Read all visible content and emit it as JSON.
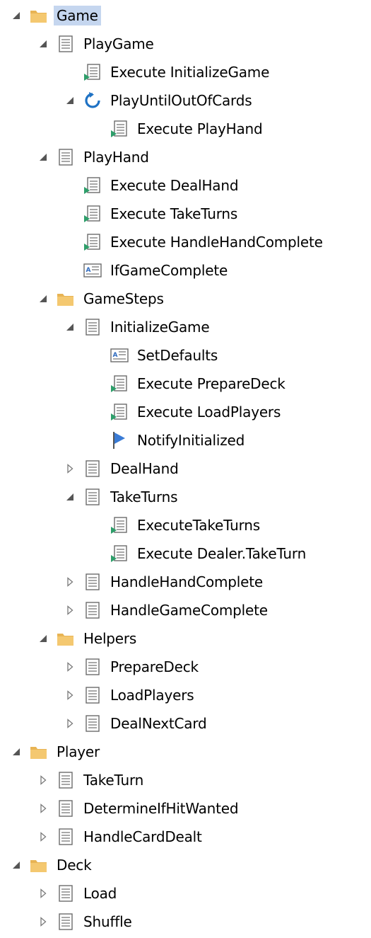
{
  "colors": {
    "selection": "#c5d6ef",
    "folder": "#f4c870",
    "folder_tab": "#e8b454",
    "flag": "#3a7bd5",
    "loop": "#1f72c4",
    "execute_arrow": "#2e9e6a",
    "expander": "#555555"
  },
  "tree": [
    {
      "label": "Game",
      "level": 0,
      "icon": "folder-icon",
      "expander": "expanded",
      "selected": true
    },
    {
      "label": "PlayGame",
      "level": 1,
      "icon": "document-icon",
      "expander": "expanded"
    },
    {
      "label": "Execute InitializeGame",
      "level": 2,
      "icon": "execute-icon",
      "expander": "none"
    },
    {
      "label": "PlayUntilOutOfCards",
      "level": 2,
      "icon": "loop-icon",
      "expander": "expanded"
    },
    {
      "label": "Execute PlayHand",
      "level": 3,
      "icon": "execute-icon",
      "expander": "none"
    },
    {
      "label": "PlayHand",
      "level": 1,
      "icon": "document-icon",
      "expander": "expanded"
    },
    {
      "label": "Execute DealHand",
      "level": 2,
      "icon": "execute-icon",
      "expander": "none"
    },
    {
      "label": "Execute TakeTurns",
      "level": 2,
      "icon": "execute-icon",
      "expander": "none"
    },
    {
      "label": "Execute HandleHandComplete",
      "level": 2,
      "icon": "execute-icon",
      "expander": "none"
    },
    {
      "label": "IfGameComplete",
      "level": 2,
      "icon": "condition-icon",
      "expander": "none"
    },
    {
      "label": "GameSteps",
      "level": 1,
      "icon": "folder-icon",
      "expander": "expanded"
    },
    {
      "label": "InitializeGame",
      "level": 2,
      "icon": "document-icon",
      "expander": "expanded"
    },
    {
      "label": "SetDefaults",
      "level": 3,
      "icon": "condition-icon",
      "expander": "none"
    },
    {
      "label": "Execute PrepareDeck",
      "level": 3,
      "icon": "execute-icon",
      "expander": "none"
    },
    {
      "label": "Execute LoadPlayers",
      "level": 3,
      "icon": "execute-icon",
      "expander": "none"
    },
    {
      "label": "NotifyInitialized",
      "level": 3,
      "icon": "flag-icon",
      "expander": "none"
    },
    {
      "label": "DealHand",
      "level": 2,
      "icon": "document-icon",
      "expander": "collapsed"
    },
    {
      "label": "TakeTurns",
      "level": 2,
      "icon": "document-icon",
      "expander": "expanded"
    },
    {
      "label": "ExecuteTakeTurns",
      "level": 3,
      "icon": "execute-icon",
      "expander": "none"
    },
    {
      "label": "Execute Dealer.TakeTurn",
      "level": 3,
      "icon": "execute-icon",
      "expander": "none"
    },
    {
      "label": "HandleHandComplete",
      "level": 2,
      "icon": "document-icon",
      "expander": "collapsed"
    },
    {
      "label": "HandleGameComplete",
      "level": 2,
      "icon": "document-icon",
      "expander": "collapsed"
    },
    {
      "label": "Helpers",
      "level": 1,
      "icon": "folder-icon",
      "expander": "expanded"
    },
    {
      "label": "PrepareDeck",
      "level": 2,
      "icon": "document-icon",
      "expander": "collapsed"
    },
    {
      "label": "LoadPlayers",
      "level": 2,
      "icon": "document-icon",
      "expander": "collapsed"
    },
    {
      "label": "DealNextCard",
      "level": 2,
      "icon": "document-icon",
      "expander": "collapsed"
    },
    {
      "label": "Player",
      "level": 0,
      "icon": "folder-icon",
      "expander": "expanded"
    },
    {
      "label": "TakeTurn",
      "level": 1,
      "icon": "document-icon",
      "expander": "collapsed"
    },
    {
      "label": "DetermineIfHitWanted",
      "level": 1,
      "icon": "document-icon",
      "expander": "collapsed"
    },
    {
      "label": "HandleCardDealt",
      "level": 1,
      "icon": "document-icon",
      "expander": "collapsed"
    },
    {
      "label": "Deck",
      "level": 0,
      "icon": "folder-icon",
      "expander": "expanded"
    },
    {
      "label": "Load",
      "level": 1,
      "icon": "document-icon",
      "expander": "collapsed"
    },
    {
      "label": "Shuffle",
      "level": 1,
      "icon": "document-icon",
      "expander": "collapsed"
    }
  ]
}
